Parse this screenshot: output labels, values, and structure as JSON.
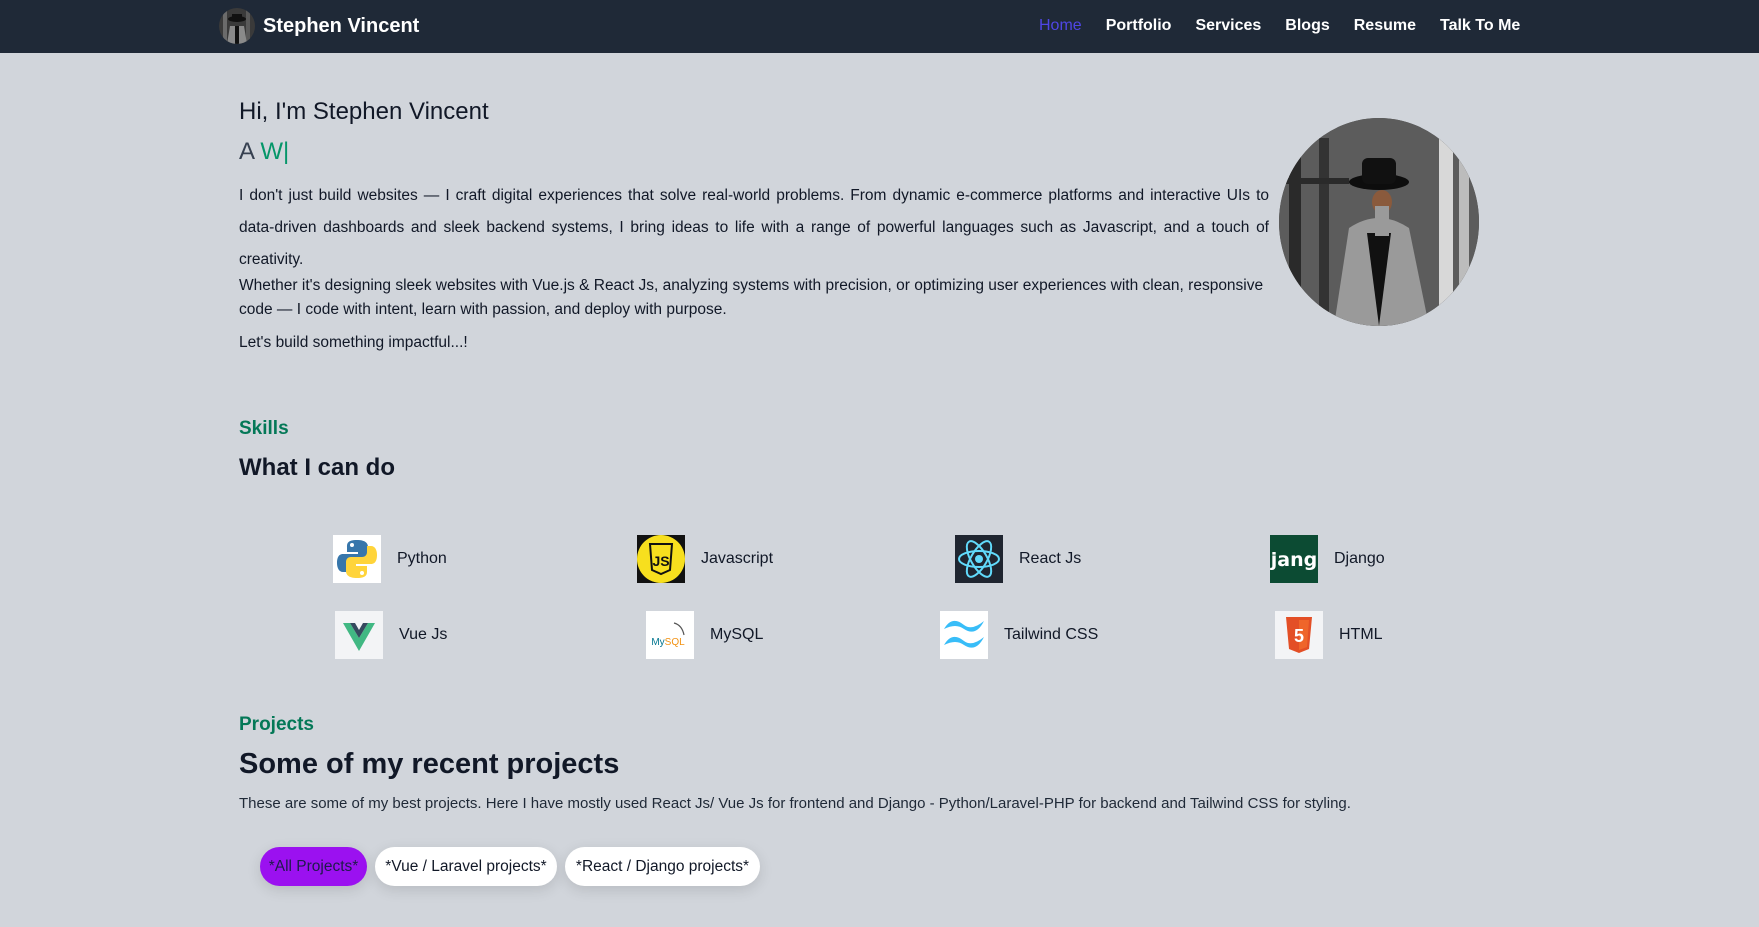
{
  "header": {
    "brand_name": "Stephen Vincent",
    "nav_links": [
      "Home",
      "Portfolio",
      "Services",
      "Blogs",
      "Resume",
      "Talk To Me"
    ],
    "active_link": "Home"
  },
  "hero": {
    "greeting": "Hi, I'm Stephen Vincent",
    "typing_prefix": "A",
    "typing_text": "W|",
    "paragraph1": "I don't just build websites — I craft digital experiences that solve real-world problems. From dynamic e-commerce platforms and interactive UIs to data-driven dashboards and sleek backend systems, I bring ideas to life with a range of powerful languages such as Javascript, and a touch of creativity.",
    "paragraph2": "Whether it's designing sleek websites with Vue.js & React Js, analyzing systems with precision, or optimizing user experiences with clean, responsive code — I code with intent, learn with passion, and deploy with purpose.",
    "paragraph3": "Let's build something impactful...!"
  },
  "skills": {
    "label": "Skills",
    "title": "What I can do",
    "items": [
      {
        "name": "Python",
        "icon": "python-logo-icon"
      },
      {
        "name": "Javascript",
        "icon": "javascript-logo-icon"
      },
      {
        "name": "React Js",
        "icon": "react-logo-icon"
      },
      {
        "name": "Django",
        "icon": "django-logo-icon"
      },
      {
        "name": "Vue Js",
        "icon": "vue-logo-icon"
      },
      {
        "name": "MySQL",
        "icon": "mysql-logo-icon"
      },
      {
        "name": "Tailwind CSS",
        "icon": "tailwind-logo-icon"
      },
      {
        "name": "HTML",
        "icon": "html5-logo-icon"
      }
    ]
  },
  "projects": {
    "label": "Projects",
    "title": "Some of my recent projects",
    "description": "These are some of my best projects. Here I have mostly used React Js/ Vue Js for frontend and Django - Python/Laravel-PHP for backend and Tailwind CSS for styling.",
    "filters": [
      "*All Projects*",
      "*Vue / Laravel projects*",
      "*React / Django projects*"
    ],
    "active_filter": "*All Projects*"
  },
  "colors": {
    "nav_bg": "#1f2937",
    "page_bg": "#d1d5db",
    "accent_green": "#047857",
    "active_link": "#4f46e5",
    "active_filter": "#9b11f0"
  }
}
